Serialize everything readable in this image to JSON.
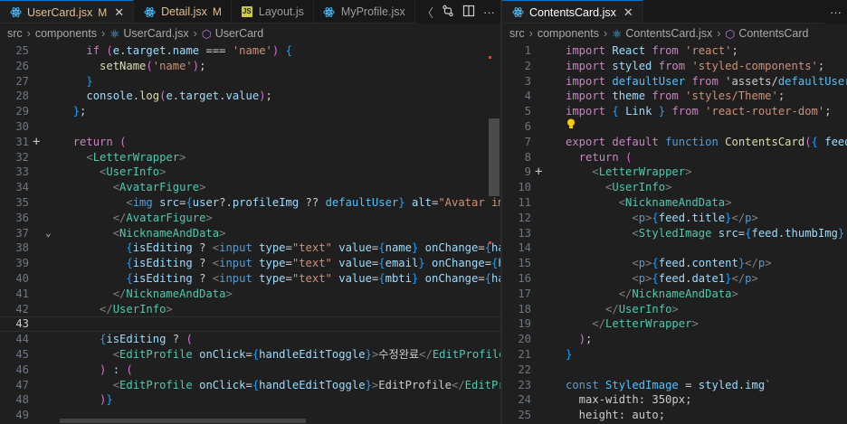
{
  "left": {
    "tabs": [
      {
        "label": "UserCard.jsx",
        "badge": "M",
        "icon": "react-icon",
        "active": true,
        "modified": true,
        "close": "✕"
      },
      {
        "label": "Detail.jsx",
        "badge": "M",
        "icon": "react-icon",
        "active": false,
        "modified": true
      },
      {
        "label": "Layout.js",
        "badge": "",
        "icon": "js-icon",
        "active": false,
        "modified": false
      },
      {
        "label": "MyProfile.jsx",
        "badge": "",
        "icon": "react-icon",
        "active": false,
        "modified": false
      }
    ],
    "actions": [
      "〈",
      "compare-icon",
      "split-editor-icon",
      "···"
    ],
    "breadcrumb": [
      "src",
      "components",
      "UserCard.jsx",
      "UserCard"
    ],
    "lines": [
      {
        "n": "25",
        "code": "    if (e.target.name === 'name') {"
      },
      {
        "n": "26",
        "code": "      setName('name');"
      },
      {
        "n": "27",
        "code": "    }"
      },
      {
        "n": "28",
        "code": "    console.log(e.target.value);"
      },
      {
        "n": "29",
        "code": "  };"
      },
      {
        "n": "30",
        "code": ""
      },
      {
        "n": "31",
        "code": "  return ("
      },
      {
        "n": "32",
        "code": "    <LetterWrapper>"
      },
      {
        "n": "33",
        "code": "      <UserInfo>"
      },
      {
        "n": "34",
        "code": "        <AvatarFigure>"
      },
      {
        "n": "35",
        "code": "          <img src={user?.profileImg ?? defaultUser} alt=\"Avatar image\""
      },
      {
        "n": "36",
        "code": "        </AvatarFigure>"
      },
      {
        "n": "37",
        "code": "        <NicknameAndData>"
      },
      {
        "n": "38",
        "code": "          {isEditing ? <input type=\"text\" value={name} onChange={handleI"
      },
      {
        "n": "39",
        "code": "          {isEditing ? <input type=\"text\" value={email} onChange={handle"
      },
      {
        "n": "40",
        "code": "          {isEditing ? <input type=\"text\" value={mbti} onChange={handleI"
      },
      {
        "n": "41",
        "code": "        </NicknameAndData>"
      },
      {
        "n": "42",
        "code": "      </UserInfo>"
      },
      {
        "n": "43",
        "code": ""
      },
      {
        "n": "44",
        "code": "      {isEditing ? ("
      },
      {
        "n": "45",
        "code": "        <EditProfile onClick={handleEditToggle}>수정완료</EditProfile>"
      },
      {
        "n": "46",
        "code": "      ) : ("
      },
      {
        "n": "47",
        "code": "        <EditProfile onClick={handleEditToggle}>EditProfile</EditProfile"
      },
      {
        "n": "48",
        "code": "      )}"
      },
      {
        "n": "49",
        "code": ""
      }
    ]
  },
  "right": {
    "tabs": [
      {
        "label": "ContentsCard.jsx",
        "badge": "",
        "icon": "react-icon",
        "active": true,
        "modified": false,
        "close": "✕"
      }
    ],
    "actions": [
      "···"
    ],
    "breadcrumb": [
      "src",
      "components",
      "ContentsCard.jsx",
      "ContentsCard"
    ],
    "lines": [
      {
        "n": "1",
        "code": "import React from 'react';"
      },
      {
        "n": "2",
        "code": "import styled from 'styled-components';"
      },
      {
        "n": "3",
        "code": "import defaultUser from 'assets/defaultUser.pn"
      },
      {
        "n": "4",
        "code": "import theme from 'styles/Theme';"
      },
      {
        "n": "5",
        "code": "import { Link } from 'react-router-dom';"
      },
      {
        "n": "6",
        "code": ""
      },
      {
        "n": "7",
        "code": "export default function ContentsCard({ feed })"
      },
      {
        "n": "8",
        "code": "  return ("
      },
      {
        "n": "9",
        "code": "    <LetterWrapper>"
      },
      {
        "n": "10",
        "code": "      <UserInfo>"
      },
      {
        "n": "11",
        "code": "        <NicknameAndData>"
      },
      {
        "n": "12",
        "code": "          <p>{feed.title}</p>"
      },
      {
        "n": "13",
        "code": "          <StyledImage src={feed.thumbImg} alt"
      },
      {
        "n": "14",
        "code": ""
      },
      {
        "n": "15",
        "code": "          <p>{feed.content}</p>"
      },
      {
        "n": "16",
        "code": "          <p>{feed.date1}</p>"
      },
      {
        "n": "17",
        "code": "        </NicknameAndData>"
      },
      {
        "n": "18",
        "code": "      </UserInfo>"
      },
      {
        "n": "19",
        "code": "    </LetterWrapper>"
      },
      {
        "n": "20",
        "code": "  );"
      },
      {
        "n": "21",
        "code": "}"
      },
      {
        "n": "22",
        "code": ""
      },
      {
        "n": "23",
        "code": "const StyledImage = styled.img`"
      },
      {
        "n": "24",
        "code": "  max-width: 350px;"
      },
      {
        "n": "25",
        "code": "  height: auto;"
      }
    ]
  },
  "colors": {
    "accent": "#0078d4",
    "modified": "#e2c08d",
    "background": "#1f1f1f"
  }
}
